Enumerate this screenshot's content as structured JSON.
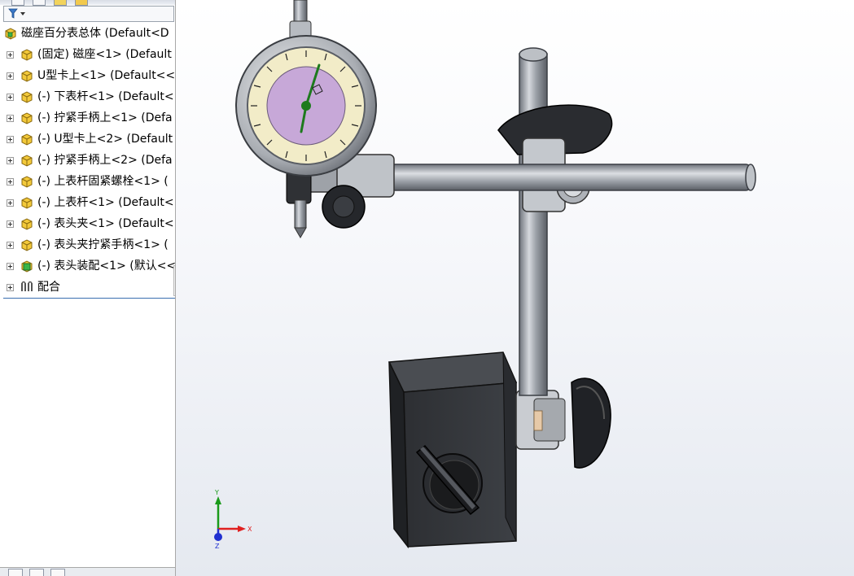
{
  "feature_tree": {
    "filter_icon": "filter-funnel-icon",
    "root": {
      "label": "磁座百分表总体 (Default<D",
      "icon": "assembly-icon"
    },
    "items": [
      {
        "label": "(固定) 磁座<1> (Default",
        "icon": "part-icon"
      },
      {
        "label": "U型卡上<1> (Default<<",
        "icon": "part-icon"
      },
      {
        "label": "(-) 下表杆<1> (Default<",
        "icon": "part-icon"
      },
      {
        "label": "(-) 拧紧手柄上<1> (Defa",
        "icon": "part-icon"
      },
      {
        "label": "(-) U型卡上<2> (Default",
        "icon": "part-icon"
      },
      {
        "label": "(-) 拧紧手柄上<2> (Defa",
        "icon": "part-icon"
      },
      {
        "label": "(-) 上表杆固紧螺栓<1> (",
        "icon": "part-icon"
      },
      {
        "label": "(-) 上表杆<1> (Default<",
        "icon": "part-icon"
      },
      {
        "label": "(-) 表头夹<1> (Default<",
        "icon": "part-icon"
      },
      {
        "label": "(-) 表头夹拧紧手柄<1> (",
        "icon": "part-icon"
      },
      {
        "label": "(-) 表头装配<1> (默认<<",
        "icon": "subassembly-icon"
      },
      {
        "label": "配合",
        "icon": "mates-icon"
      }
    ]
  },
  "viewport": {
    "triad": {
      "x_label": "X",
      "y_label": "Y",
      "z_label": "Z"
    },
    "colors": {
      "x_axis": "#e02020",
      "y_axis": "#1a9a1a",
      "z_axis": "#2030d0",
      "dial_face": "#c7a8d8",
      "dial_ring": "#f2ecc8"
    }
  }
}
